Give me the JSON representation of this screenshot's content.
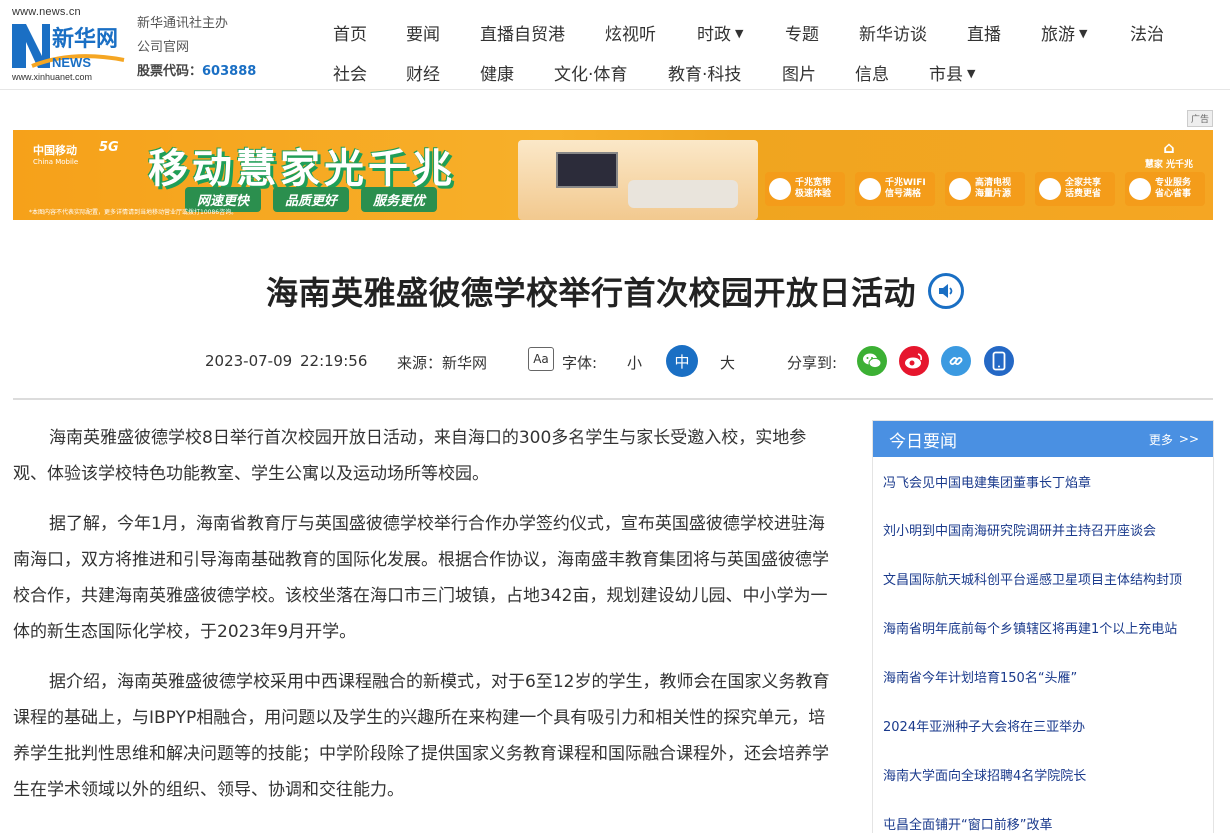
{
  "logo": {
    "url": "www.news.cn",
    "brand": "新华网",
    "news_text": "NEWS",
    "url2": "www.xinhuanet.com"
  },
  "org": {
    "line1": "新华通讯社主办",
    "line2": "公司官网",
    "stock_label": "股票代码：",
    "stock_code": "603888"
  },
  "nav": {
    "row1": [
      "首页",
      "要闻",
      "直播自贸港",
      "炫视听",
      "时政",
      "专题",
      "新华访谈",
      "直播",
      "旅游",
      "法治"
    ],
    "row2": [
      "社会",
      "财经",
      "健康",
      "文化·体育",
      "教育·科技",
      "图片",
      "信息",
      "市县"
    ]
  },
  "ad": {
    "tag": "广告",
    "brand": "中国移动",
    "brand_en": "China Mobile",
    "fiveg": "5G",
    "slogan": "移动慧家光千兆",
    "tags": [
      "网速更快",
      "品质更好",
      "服务更优"
    ],
    "features": [
      {
        "l1": "千兆宽带",
        "l2": "极速体验"
      },
      {
        "l1": "千兆WIFI",
        "l2": "信号满格"
      },
      {
        "l1": "高清电视",
        "l2": "海量片源"
      },
      {
        "l1": "全家共享",
        "l2": "话费更省"
      },
      {
        "l1": "专业服务",
        "l2": "省心省事"
      }
    ],
    "home_label": "慧家 光千兆",
    "note": "*本图内容不代表实际配置，更多详情请到当地移动营业厅或拨打10086咨询。"
  },
  "article": {
    "title": "海南英雅盛彼德学校举行首次校园开放日活动",
    "date": "2023-07-09",
    "time": "22:19:56",
    "source": "来源：新华网",
    "font_icon": "Aa",
    "font_label": "字体:",
    "font_small": "小",
    "font_mid": "中",
    "font_large": "大",
    "share_label": "分享到:",
    "paragraphs": [
      "海南英雅盛彼德学校8日举行首次校园开放日活动，来自海口的300多名学生与家长受邀入校，实地参观、体验该学校特色功能教室、学生公寓以及运动场所等校园。",
      "据了解，今年1月，海南省教育厅与英国盛彼德学校举行合作办学签约仪式，宣布英国盛彼德学校进驻海南海口，双方将推进和引导海南基础教育的国际化发展。根据合作协议，海南盛丰教育集团将与英国盛彼德学校合作，共建海南英雅盛彼德学校。该校坐落在海口市三门坡镇，占地342亩，规划建设幼儿园、中小学为一体的新生态国际化学校，于2023年9月开学。",
      "据介绍，海南英雅盛彼德学校采用中西课程融合的新模式，对于6至12岁的学生，教师会在国家义务教育课程的基础上，与IBPYP相融合，用问题以及学生的兴趣所在来构建一个具有吸引力和相关性的探究单元，培养学生批判性思维和解决问题等的技能；中学阶段除了提供国家义务教育课程和国际融合课程外，还会培养学生在学术领域以外的组织、领导、协调和交往能力。"
    ]
  },
  "sidebar": {
    "title": "今日要闻",
    "more": "更多",
    "items": [
      "冯飞会见中国电建集团董事长丁焰章",
      "刘小明到中国南海研究院调研并主持召开座谈会",
      "文昌国际航天城科创平台遥感卫星项目主体结构封顶",
      "海南省明年底前每个乡镇辖区将再建1个以上充电站",
      "海南省今年计划培育150名“头雁”",
      "2024年亚洲种子大会将在三亚举办",
      "海南大学面向全球招聘4名学院院长",
      "屯昌全面铺开“窗口前移”改革"
    ]
  },
  "colors": {
    "accent": "#1a6fc4",
    "sidebar_head": "#4a90e2",
    "ad_bg": "#f6a11a",
    "ad_green": "#1f9e58"
  }
}
